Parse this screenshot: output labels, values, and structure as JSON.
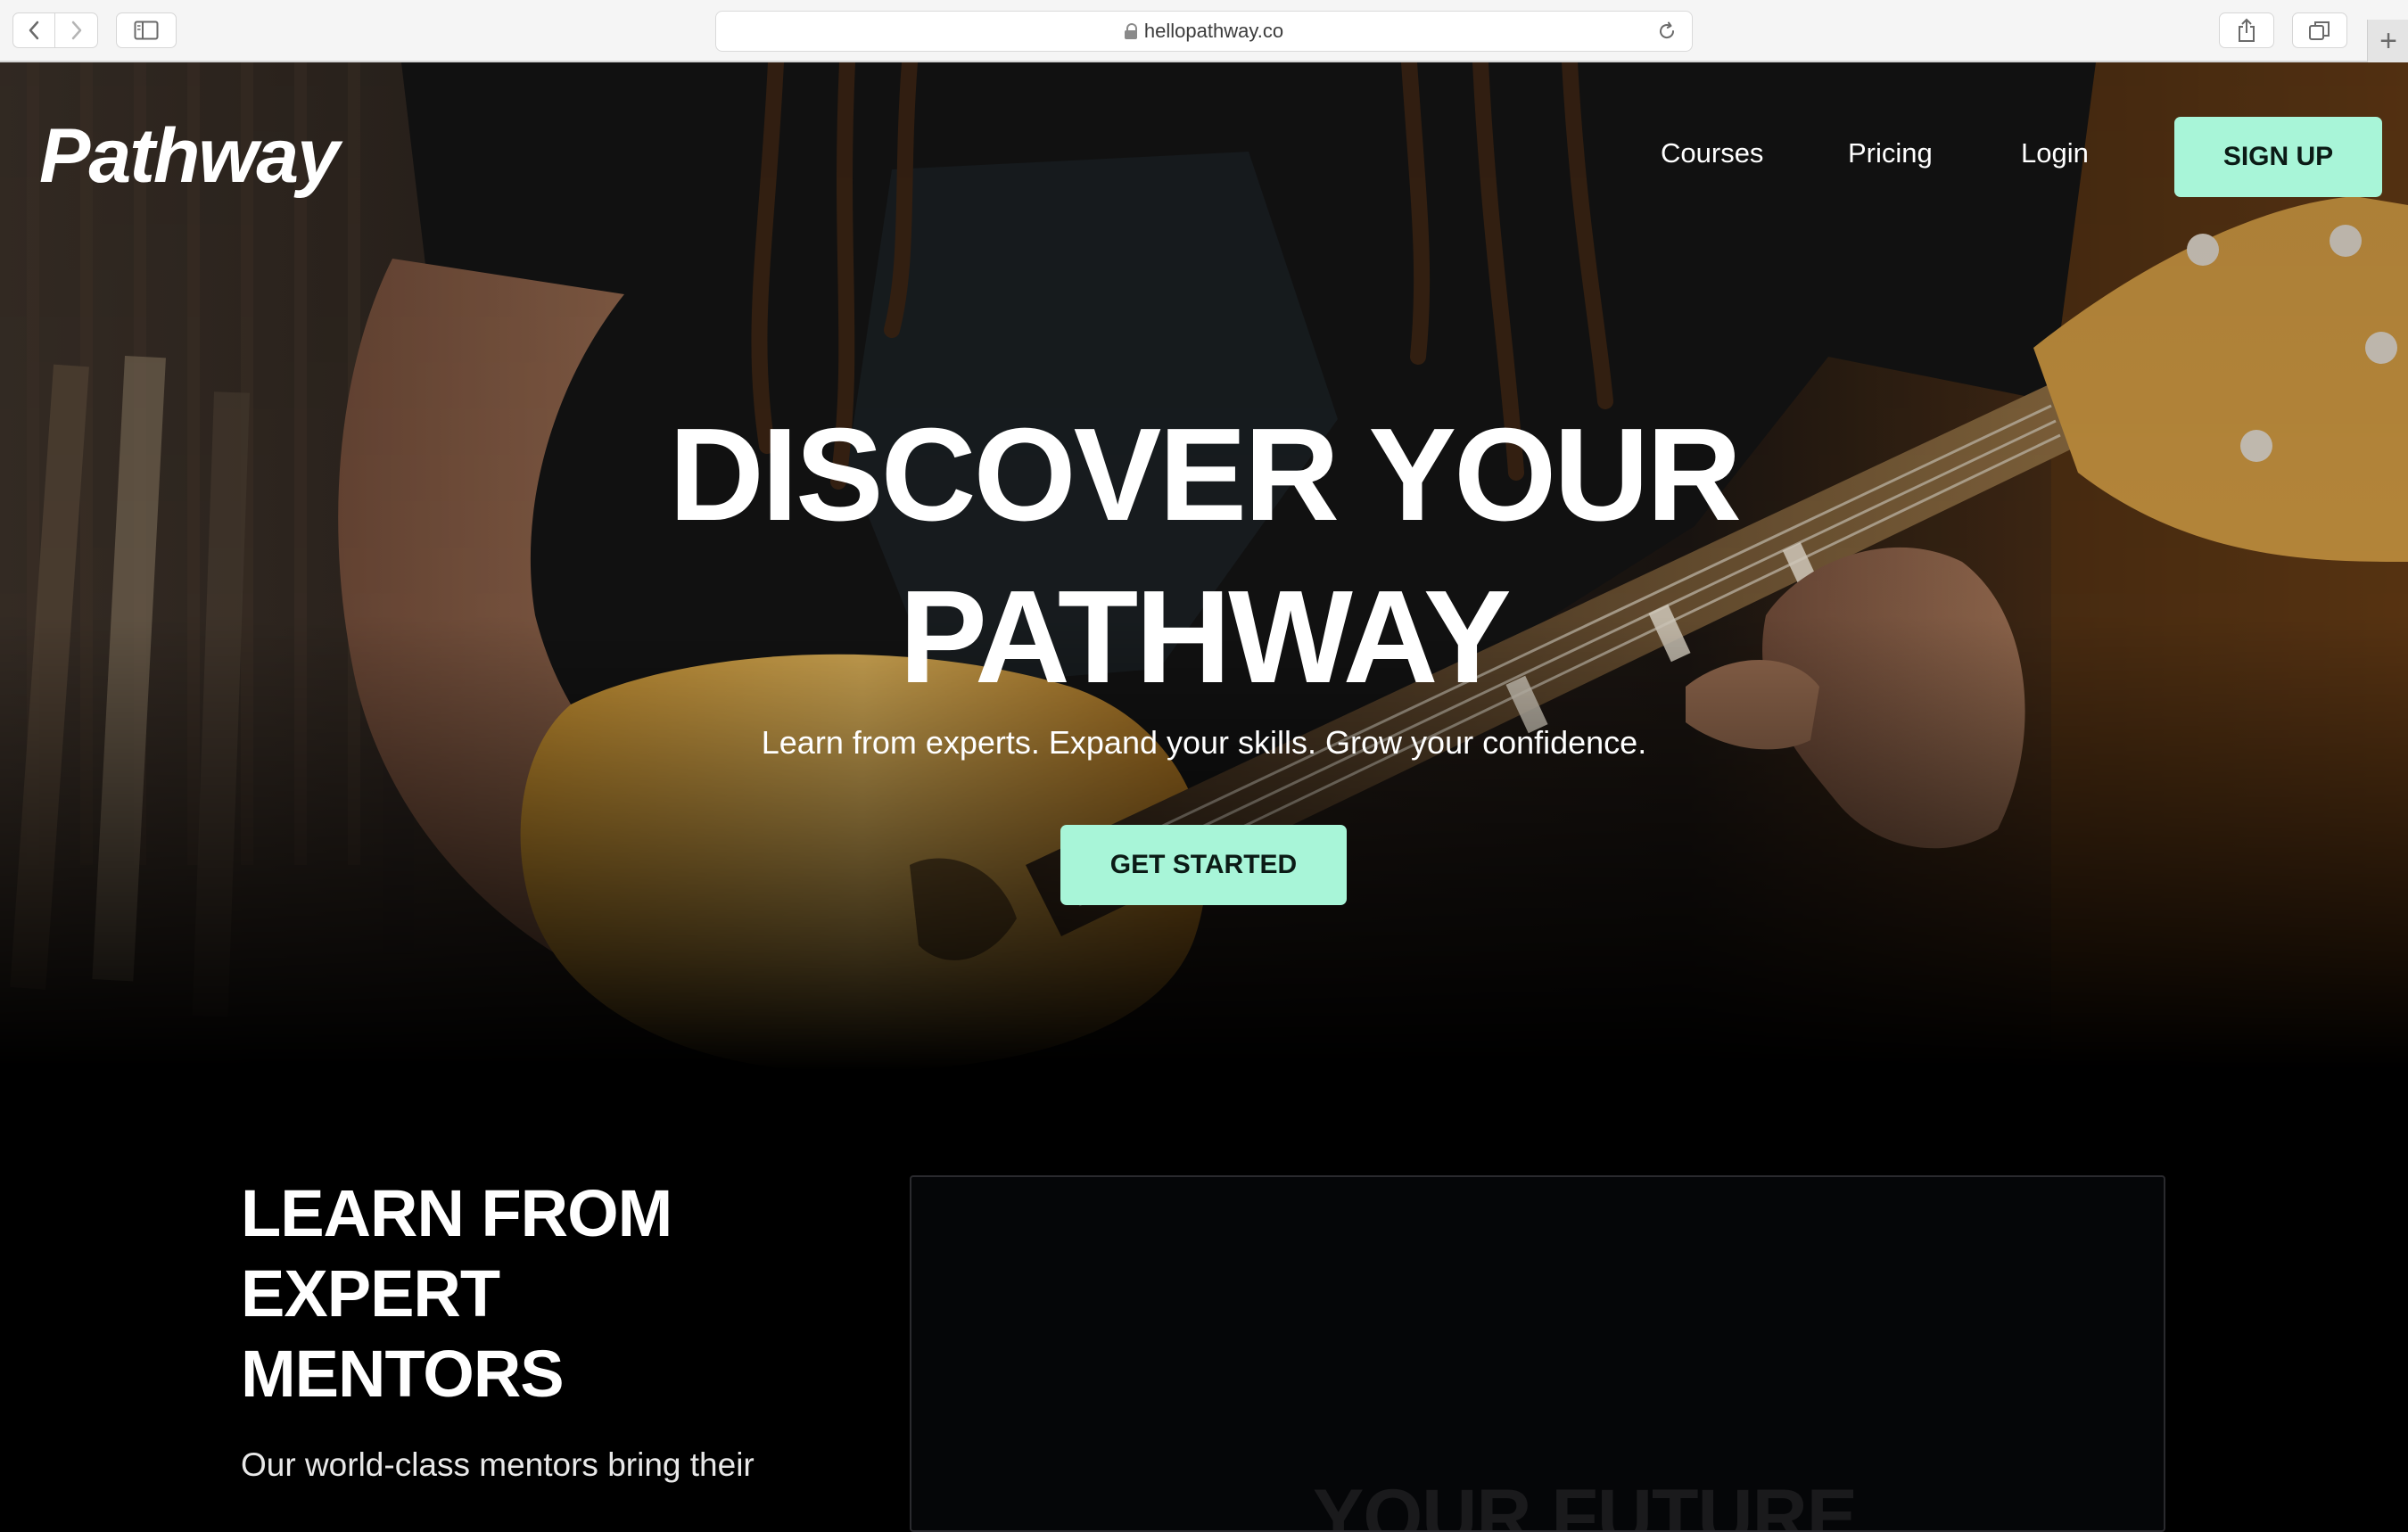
{
  "browser": {
    "url": "hellopathway.co",
    "new_tab_label": "+"
  },
  "header": {
    "logo": "Pathway",
    "nav": [
      "Courses",
      "Pricing",
      "Login"
    ],
    "signup_label": "SIGN UP"
  },
  "hero": {
    "title_line1": "DISCOVER YOUR",
    "title_line2": "PATHWAY",
    "subtitle": "Learn from experts. Expand your skills. Grow your confidence.",
    "cta_label": "GET STARTED"
  },
  "mentors": {
    "title_line1": "LEARN FROM",
    "title_line2": "EXPERT",
    "title_line3": "MENTORS",
    "body": "Our world-class mentors bring their",
    "video_text": "YOUR FUTURE"
  },
  "colors": {
    "accent": "#a8f5d8",
    "page_bg": "#000000",
    "text": "#ffffff"
  }
}
